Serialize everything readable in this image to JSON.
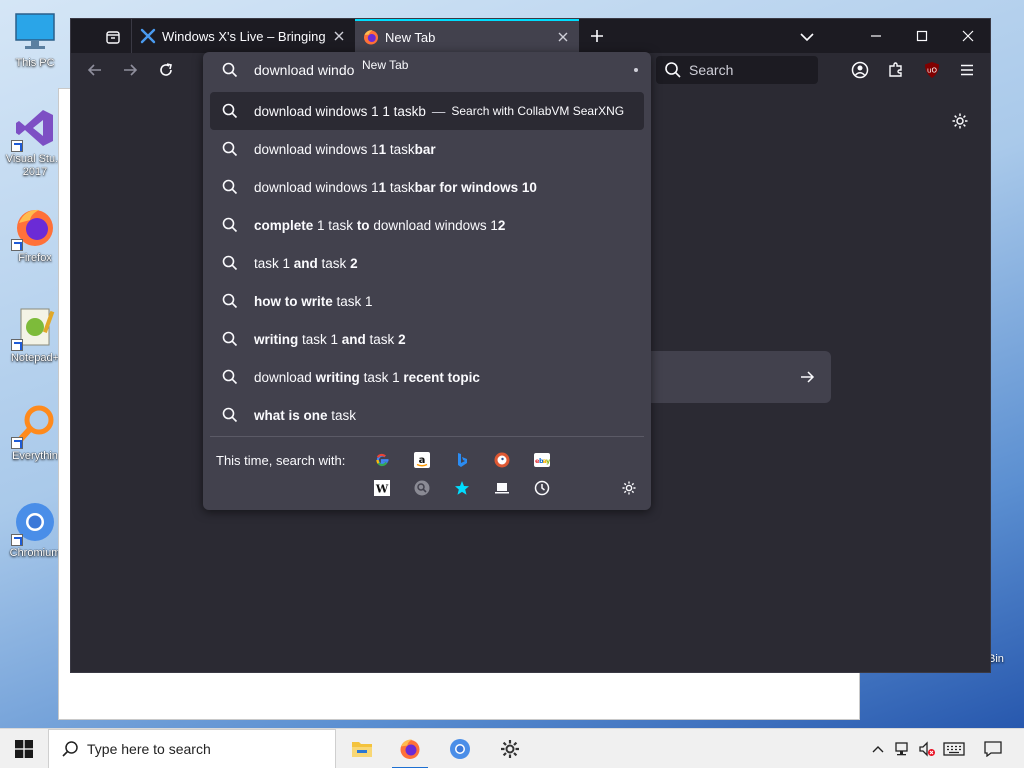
{
  "desktop": {
    "icons": [
      {
        "label": "This PC"
      },
      {
        "label": "Visual Stu..."
      },
      {
        "label": "2017"
      },
      {
        "label": "Firefox"
      },
      {
        "label": "Notepad+"
      },
      {
        "label": "Everythin"
      },
      {
        "label": "Chromium"
      }
    ],
    "recycle_bin_partial": "Bin"
  },
  "browser": {
    "tabs": [
      {
        "title": "Windows X's Live – Bringing the",
        "favicon": "wx-logo-icon"
      },
      {
        "title": "New Tab",
        "favicon": "firefox-icon"
      }
    ],
    "search_placeholder": "Search",
    "urlbar_text": "download windo",
    "tab_tooltip": "New Tab",
    "accent_color": "#00ddff",
    "suggestions": [
      {
        "parts": [
          {
            "t": "download windows 1 1 taskb",
            "b": false
          }
        ],
        "action": "Search with CollabVM SearXNG",
        "selected": true
      },
      {
        "parts": [
          {
            "t": "download windows 1",
            "b": false
          },
          {
            "t": "1",
            "b": true
          },
          {
            "t": " task",
            "b": false
          },
          {
            "t": "bar",
            "b": true
          }
        ]
      },
      {
        "parts": [
          {
            "t": "download windows 1",
            "b": false
          },
          {
            "t": "1",
            "b": true
          },
          {
            "t": " task",
            "b": false
          },
          {
            "t": "bar for windows 1",
            "b": true
          },
          {
            "t": "0",
            "b": true
          }
        ]
      },
      {
        "parts": [
          {
            "t": "complete",
            "b": true
          },
          {
            "t": " 1 task ",
            "b": false
          },
          {
            "t": "to",
            "b": true
          },
          {
            "t": " download windows 1",
            "b": false
          },
          {
            "t": "2",
            "b": true
          }
        ]
      },
      {
        "parts": [
          {
            "t": "task 1 ",
            "b": false
          },
          {
            "t": "and",
            "b": true
          },
          {
            "t": " task ",
            "b": false
          },
          {
            "t": "2",
            "b": true
          }
        ]
      },
      {
        "parts": [
          {
            "t": "how to write",
            "b": true
          },
          {
            "t": " task 1",
            "b": false
          }
        ]
      },
      {
        "parts": [
          {
            "t": "writing",
            "b": true
          },
          {
            "t": " task 1 ",
            "b": false
          },
          {
            "t": "and",
            "b": true
          },
          {
            "t": " task ",
            "b": false
          },
          {
            "t": "2",
            "b": true
          }
        ]
      },
      {
        "parts": [
          {
            "t": "download ",
            "b": false
          },
          {
            "t": "writing",
            "b": true
          },
          {
            "t": " task 1 ",
            "b": false
          },
          {
            "t": "recent topic",
            "b": true
          }
        ]
      },
      {
        "parts": [
          {
            "t": "what is one",
            "b": true
          },
          {
            "t": " task",
            "b": false
          }
        ]
      }
    ],
    "oneoff_label": "This time, search with:",
    "oneoff_engines": [
      "google-icon",
      "amazon-icon",
      "bing-icon",
      "duckduckgo-icon",
      "ebay-icon",
      "wikipedia-icon",
      "searxng-icon",
      "bookmarks-icon",
      "tabs-icon",
      "history-icon"
    ]
  },
  "taskbar": {
    "search_placeholder": "Type here to search",
    "apps": [
      "file-explorer-icon",
      "firefox-icon",
      "chromium-icon",
      "settings-icon"
    ]
  }
}
